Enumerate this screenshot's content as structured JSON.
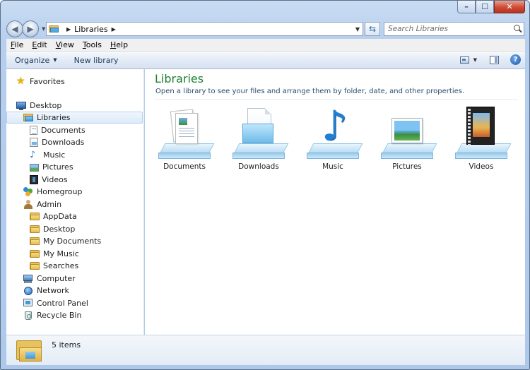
{
  "window": {
    "controls": {
      "minimize": "–",
      "maximize": "☐",
      "close": "✕"
    }
  },
  "address": {
    "path": "Libraries",
    "separator_before": "▶",
    "separator_after": "▶"
  },
  "search": {
    "placeholder": "Search Libraries"
  },
  "menu": {
    "items": [
      {
        "pre": "",
        "key": "F",
        "post": "ile"
      },
      {
        "pre": "",
        "key": "E",
        "post": "dit"
      },
      {
        "pre": "",
        "key": "V",
        "post": "iew"
      },
      {
        "pre": "",
        "key": "T",
        "post": "ools"
      },
      {
        "pre": "",
        "key": "H",
        "post": "elp"
      }
    ]
  },
  "commands": {
    "organize": "Organize",
    "new_library": "New library"
  },
  "nav": {
    "items": [
      {
        "label": "Favorites",
        "icon": "star-icon"
      },
      {
        "label": "Desktop",
        "icon": "desktop-icon"
      },
      {
        "label": "Libraries",
        "icon": "libraries-icon",
        "selected": true
      },
      {
        "label": "Documents",
        "icon": "documents-icon"
      },
      {
        "label": "Downloads",
        "icon": "downloads-icon"
      },
      {
        "label": "Music",
        "icon": "music-icon"
      },
      {
        "label": "Pictures",
        "icon": "pictures-icon"
      },
      {
        "label": "Videos",
        "icon": "videos-icon"
      },
      {
        "label": "Homegroup",
        "icon": "homegroup-icon"
      },
      {
        "label": "Admin",
        "icon": "user-folder-icon"
      },
      {
        "label": "AppData",
        "icon": "folder-icon"
      },
      {
        "label": "Desktop",
        "icon": "folder-icon"
      },
      {
        "label": "My Documents",
        "icon": "folder-icon"
      },
      {
        "label": "My Music",
        "icon": "folder-icon"
      },
      {
        "label": "Searches",
        "icon": "folder-icon"
      },
      {
        "label": "Computer",
        "icon": "computer-icon"
      },
      {
        "label": "Network",
        "icon": "network-icon"
      },
      {
        "label": "Control Panel",
        "icon": "control-panel-icon"
      },
      {
        "label": "Recycle Bin",
        "icon": "recycle-bin-icon"
      }
    ]
  },
  "main": {
    "title": "Libraries",
    "subtitle": "Open a library to see your files and arrange them by folder, date, and other properties.",
    "libraries": [
      {
        "label": "Documents",
        "icon": "documents-library-icon"
      },
      {
        "label": "Downloads",
        "icon": "downloads-library-icon"
      },
      {
        "label": "Music",
        "icon": "music-library-icon"
      },
      {
        "label": "Pictures",
        "icon": "pictures-library-icon"
      },
      {
        "label": "Videos",
        "icon": "videos-library-icon"
      }
    ]
  },
  "details": {
    "count_text": "5 items"
  },
  "colors": {
    "title_green": "#1e8132",
    "command_text": "#1e395b",
    "selection": "#dceaf9"
  }
}
